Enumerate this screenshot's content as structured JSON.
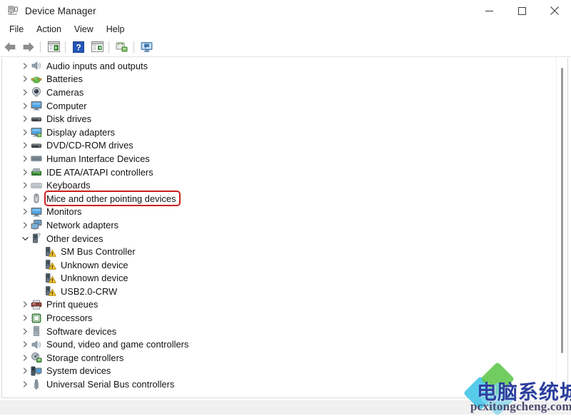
{
  "window": {
    "title": "Device Manager",
    "icon": "device-manager-icon",
    "controls": [
      {
        "name": "minimize-button",
        "glyph": "minimize-icon",
        "label": "Minimize"
      },
      {
        "name": "maximize-button",
        "glyph": "maximize-icon",
        "label": "Maximize"
      },
      {
        "name": "close-button",
        "glyph": "close-icon",
        "label": "Close"
      }
    ]
  },
  "menubar": {
    "items": [
      {
        "label": "File"
      },
      {
        "label": "Action"
      },
      {
        "label": "View"
      },
      {
        "label": "Help"
      }
    ]
  },
  "toolbar": {
    "buttons": [
      {
        "name": "back-button",
        "icon": "back-arrow-icon"
      },
      {
        "name": "forward-button",
        "icon": "forward-arrow-icon"
      },
      {
        "name": "separator-1",
        "icon": "separator"
      },
      {
        "name": "show-hide-console-tree-button",
        "icon": "console-tree-icon"
      },
      {
        "name": "separator-2",
        "icon": "separator"
      },
      {
        "name": "help-button",
        "icon": "help-question-icon"
      },
      {
        "name": "properties-button",
        "icon": "properties-icon"
      },
      {
        "name": "separator-3",
        "icon": "separator"
      },
      {
        "name": "update-driver-button",
        "icon": "update-driver-icon"
      },
      {
        "name": "separator-4",
        "icon": "separator"
      },
      {
        "name": "scan-for-hardware-changes-button",
        "icon": "scan-hardware-icon"
      }
    ]
  },
  "tree": {
    "highlight_color": "#c9201f",
    "highlighted_item": "Mice and other pointing devices",
    "items": [
      {
        "label": "Audio inputs and outputs",
        "icon": "speaker-icon",
        "state": "collapsed",
        "level": 1
      },
      {
        "label": "Batteries",
        "icon": "battery-icon",
        "state": "collapsed",
        "level": 1
      },
      {
        "label": "Cameras",
        "icon": "camera-icon",
        "state": "collapsed",
        "level": 1
      },
      {
        "label": "Computer",
        "icon": "computer-icon",
        "state": "collapsed",
        "level": 1
      },
      {
        "label": "Disk drives",
        "icon": "disk-drive-icon",
        "state": "collapsed",
        "level": 1
      },
      {
        "label": "Display adapters",
        "icon": "display-adapter-icon",
        "state": "collapsed",
        "level": 1
      },
      {
        "label": "DVD/CD-ROM drives",
        "icon": "dvd-drive-icon",
        "state": "collapsed",
        "level": 1
      },
      {
        "label": "Human Interface Devices",
        "icon": "hid-icon",
        "state": "collapsed",
        "level": 1
      },
      {
        "label": "IDE ATA/ATAPI controllers",
        "icon": "ide-controller-icon",
        "state": "collapsed",
        "level": 1
      },
      {
        "label": "Keyboards",
        "icon": "keyboard-icon",
        "state": "collapsed",
        "level": 1
      },
      {
        "label": "Mice and other pointing devices",
        "icon": "mouse-icon",
        "state": "collapsed",
        "level": 1,
        "highlighted": true
      },
      {
        "label": "Monitors",
        "icon": "monitor-icon",
        "state": "collapsed",
        "level": 1
      },
      {
        "label": "Network adapters",
        "icon": "network-adapter-icon",
        "state": "collapsed",
        "level": 1
      },
      {
        "label": "Other devices",
        "icon": "other-device-icon",
        "state": "expanded",
        "level": 1
      },
      {
        "label": "SM Bus Controller",
        "icon": "warning-device-icon",
        "state": "leaf",
        "level": 2
      },
      {
        "label": "Unknown device",
        "icon": "warning-device-icon",
        "state": "leaf",
        "level": 2
      },
      {
        "label": "Unknown device",
        "icon": "warning-device-icon",
        "state": "leaf",
        "level": 2
      },
      {
        "label": "USB2.0-CRW",
        "icon": "warning-device-icon",
        "state": "leaf",
        "level": 2
      },
      {
        "label": "Print queues",
        "icon": "printer-icon",
        "state": "collapsed",
        "level": 1
      },
      {
        "label": "Processors",
        "icon": "processor-icon",
        "state": "collapsed",
        "level": 1
      },
      {
        "label": "Software devices",
        "icon": "software-device-icon",
        "state": "collapsed",
        "level": 1
      },
      {
        "label": "Sound, video and game controllers",
        "icon": "sound-controller-icon",
        "state": "collapsed",
        "level": 1
      },
      {
        "label": "Storage controllers",
        "icon": "storage-controller-icon",
        "state": "collapsed",
        "level": 1
      },
      {
        "label": "System devices",
        "icon": "system-device-icon",
        "state": "collapsed",
        "level": 1
      },
      {
        "label": "Universal Serial Bus controllers",
        "icon": "usb-controller-icon",
        "state": "collapsed",
        "level": 1
      }
    ]
  },
  "scrollbar": {
    "name": "vertical-scrollbar",
    "orientation": "vertical"
  },
  "watermark": {
    "chinese_text": "电脑系统城",
    "url_text": "pcxitongcheng.com"
  }
}
